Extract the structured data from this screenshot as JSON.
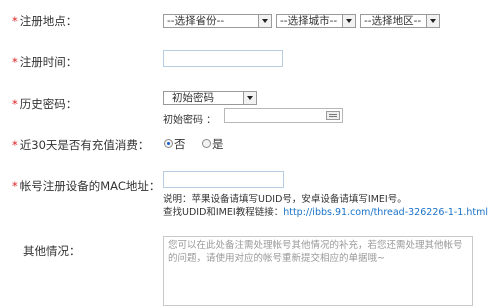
{
  "form": {
    "reg_location": {
      "label": "注册地点：",
      "province": "--选择省份--",
      "city": "--选择城市--",
      "district": "--选择地区--"
    },
    "reg_time": {
      "label": "注册时间：",
      "value": ""
    },
    "history_password": {
      "label": "历史密码：",
      "select_value": "初始密码",
      "sub_label": "初始密码 ：",
      "value": ""
    },
    "recharge": {
      "label": "近30天是否有充值消费：",
      "option_no": "否",
      "option_yes": "是",
      "selected": "否"
    },
    "mac": {
      "label": "帐号注册设备的MAC地址：",
      "value": "",
      "note_line1": "说明：苹果设备请填写UDID号，安卓设备请填写IMEI号。",
      "note_line2_prefix": "查找UDID和IMEI教程链接：",
      "note_link": "http://ibbs.91.com/thread-326226-1-1.html"
    },
    "other": {
      "label": "其他情况：",
      "placeholder": "您可以在此处备注需处理帐号其他情况的补充，若您还需处理其他帐号的问题，请使用对应的帐号重新提交相应的单据哦~"
    }
  },
  "colors": {
    "required_star": "#e02020",
    "link": "#1a73c8",
    "radio_selected": "#1a5ed8"
  }
}
